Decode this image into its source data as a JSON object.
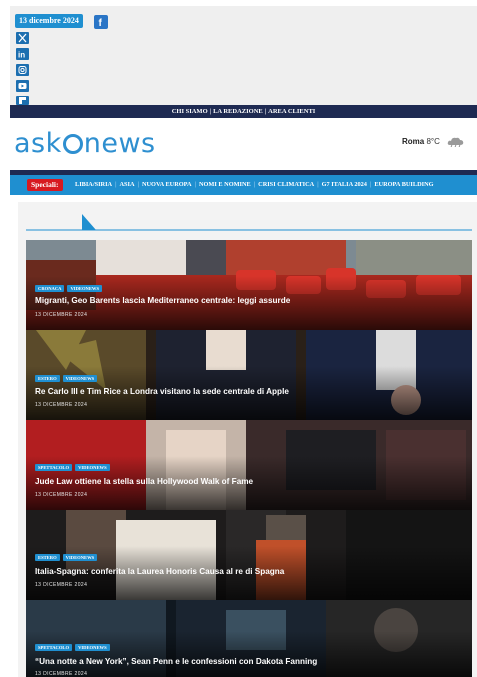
{
  "topbar": {
    "date": "13 dicembre 2024",
    "social_icons": [
      "facebook-icon",
      "x-icon",
      "linkedin-icon",
      "instagram-icon",
      "youtube-icon",
      "flipboard-icon"
    ]
  },
  "nav": {
    "items": [
      "CHI SIAMO",
      "LA REDAZIONE",
      "AREA CLIENTI"
    ]
  },
  "brand": {
    "logo_text_left": "ask",
    "logo_text_right": "news",
    "accent": "#1f8fd0",
    "dark": "#1e2a52"
  },
  "weather": {
    "city": "Roma",
    "temp": "8°C",
    "icon": "cloud-icon"
  },
  "speciali": {
    "label": "Speciali",
    "items": [
      "LIBIA/SIRIA",
      "ASIA",
      "NUOVA EUROPA",
      "NOMI E NOMINE",
      "CRISI CLIMATICA",
      "G7 ITALIA 2024",
      "EUROPA BUILDING"
    ]
  },
  "articles": [
    {
      "tags": [
        "CRONACA",
        "VIDEONEWS"
      ],
      "title": "Migranti, Geo Barents lascia Mediterraneo centrale: leggi assurde",
      "date": "13 DICEMBRE 2024"
    },
    {
      "tags": [
        "ESTERO",
        "VIDEONEWS"
      ],
      "title": "Re Carlo III e Tim Rice a Londra visitano la sede centrale di Apple",
      "date": "13 DICEMBRE 2024"
    },
    {
      "tags": [
        "SPETTACOLO",
        "VIDEONEWS"
      ],
      "title": "Jude Law ottiene la stella sulla Hollywood Walk of Fame",
      "date": "13 DICEMBRE 2024"
    },
    {
      "tags": [
        "ESTERO",
        "VIDEONEWS"
      ],
      "title": "Italia-Spagna: conferita la Laurea Honoris Causa al re di Spagna",
      "date": "13 DICEMBRE 2024"
    },
    {
      "tags": [
        "SPETTACOLO",
        "VIDEONEWS"
      ],
      "title": "“Una notte a New York”, Sean Penn e le confessioni con Dakota Fanning",
      "date": "13 DICEMBRE 2024"
    }
  ]
}
